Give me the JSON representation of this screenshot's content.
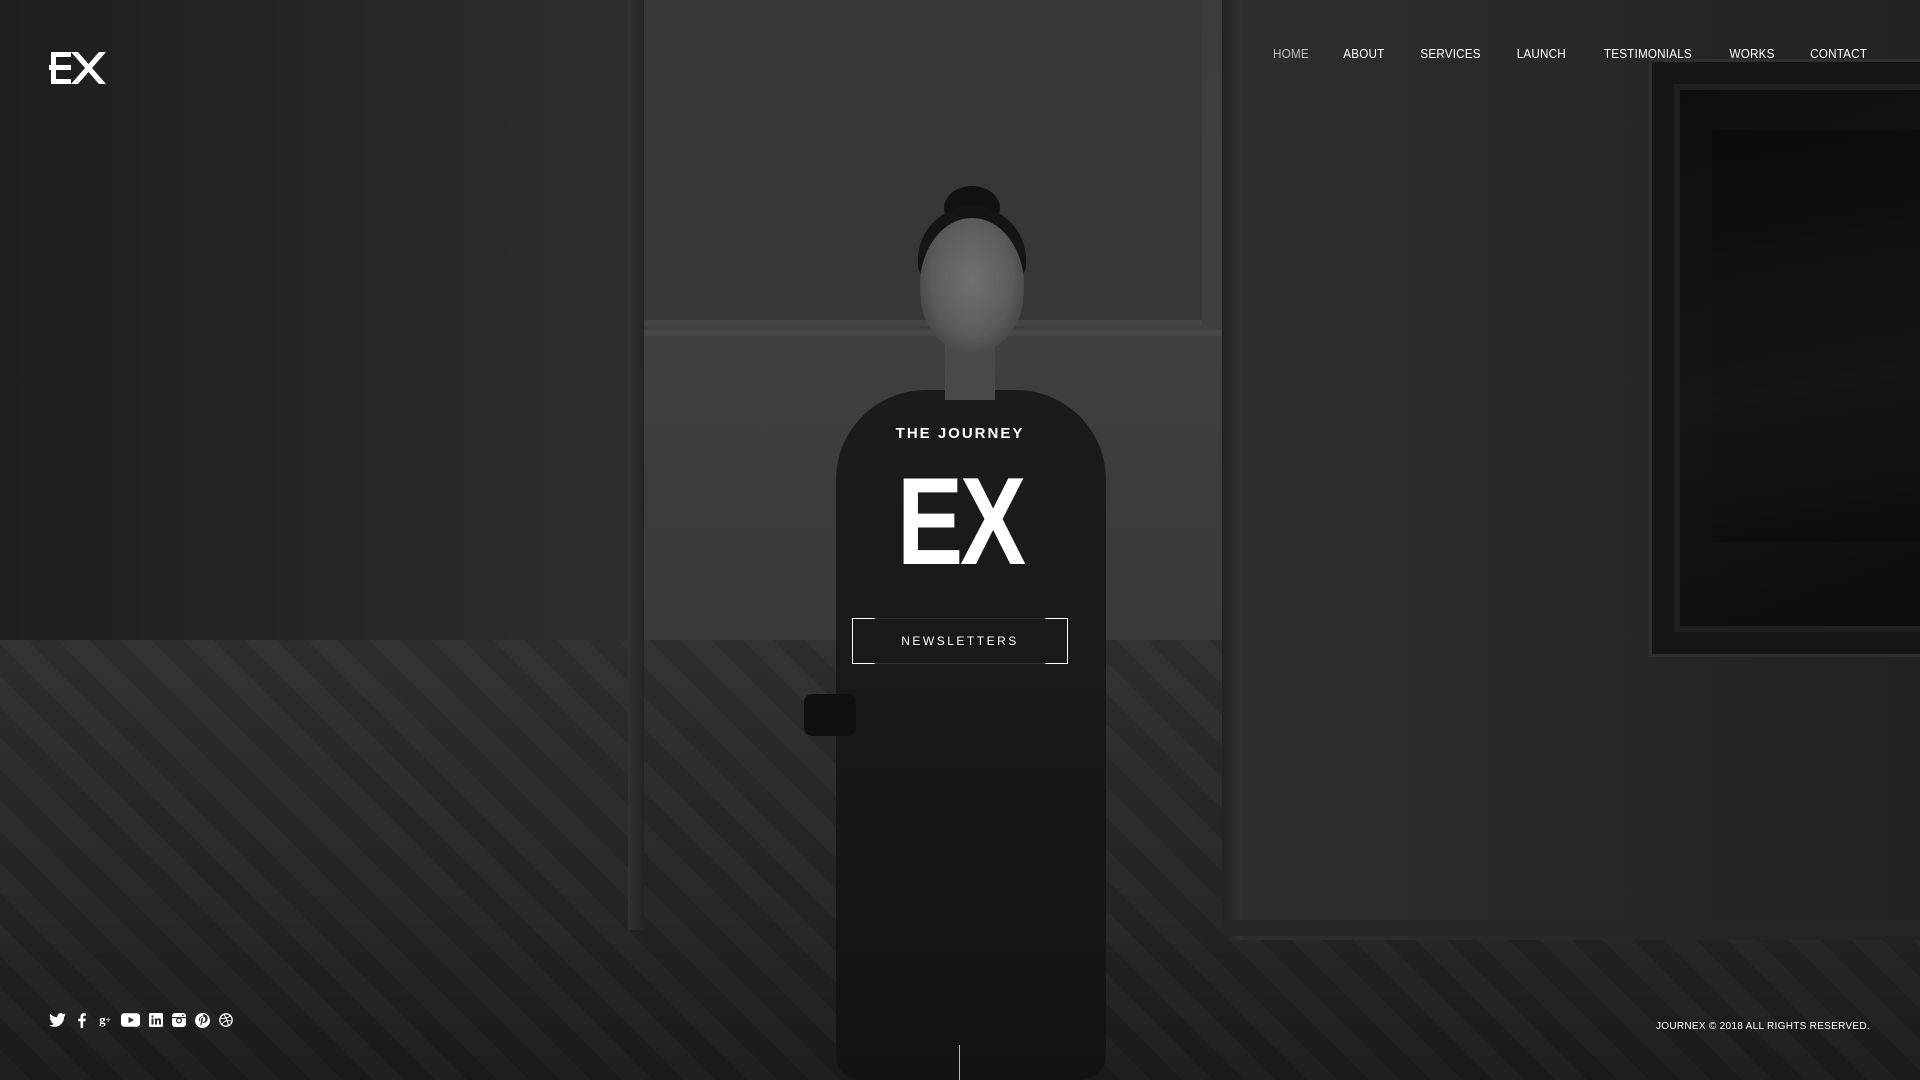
{
  "brand": {
    "logo_icon": "ex-logo-icon"
  },
  "nav": {
    "items": [
      {
        "label": "HOME",
        "active": true
      },
      {
        "label": "ABOUT"
      },
      {
        "label": "SERVICES"
      },
      {
        "label": "LAUNCH"
      },
      {
        "label": "TESTIMONIALS"
      },
      {
        "label": "WORKS"
      },
      {
        "label": "CONTACT"
      }
    ]
  },
  "hero": {
    "subtitle": "THE JOURNEY",
    "title": "EX",
    "cta_label": "NEWSLETTERS"
  },
  "footer": {
    "socials": [
      {
        "icon": "twitter-icon",
        "glyph": "🐦"
      },
      {
        "icon": "facebook-icon",
        "glyph": "f"
      },
      {
        "icon": "google-plus-icon",
        "glyph": "g+"
      },
      {
        "icon": "youtube-icon",
        "glyph": "▶"
      },
      {
        "icon": "linkedin-icon",
        "glyph": "in"
      },
      {
        "icon": "instagram-icon",
        "glyph": "◙"
      },
      {
        "icon": "pinterest-icon",
        "glyph": "ⓟ"
      },
      {
        "icon": "dribbble-icon",
        "glyph": "◎"
      }
    ],
    "copyright": "JOURNEX © 2018 ALL RIGHTS RESERVED."
  },
  "colors": {
    "text": "#ffffff",
    "nav_active": "#bdbdbd",
    "background": "#2a2a2a"
  }
}
